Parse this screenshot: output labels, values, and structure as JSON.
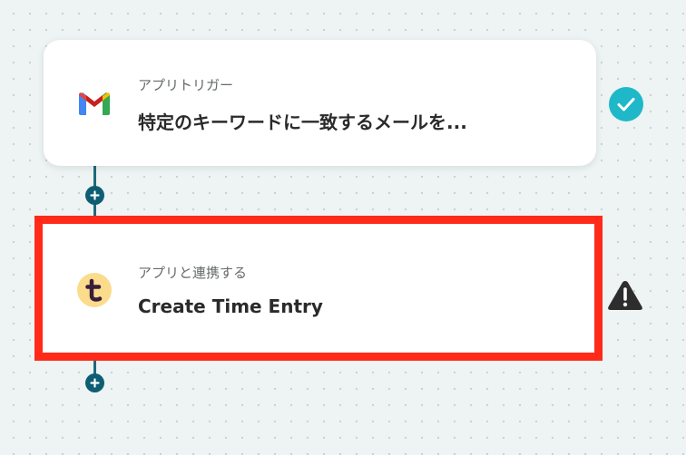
{
  "flow": {
    "steps": [
      {
        "type_label": "アプリトリガー",
        "title": "特定のキーワードに一致するメールを...",
        "app_icon": "gmail-icon",
        "status_icon": "check-circle-icon",
        "status_color": "#1fb8c8"
      },
      {
        "type_label": "アプリと連携する",
        "title": "Create Time Entry",
        "app_icon": "timely-t-icon",
        "status_icon": "warning-triangle-icon",
        "status_color": "#2d2d2d",
        "highlight_color": "#ff2a1a"
      }
    ],
    "add_step_icon": "plus-circle-icon",
    "connector_color": "#1d6b7c"
  }
}
